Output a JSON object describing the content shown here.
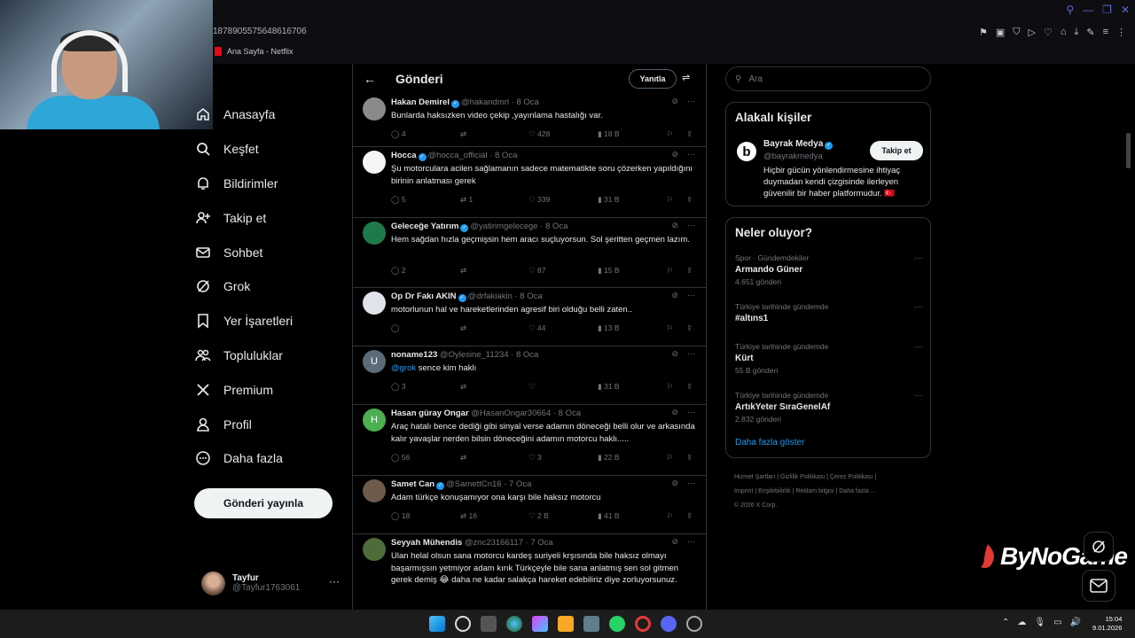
{
  "browser": {
    "address": "1878905575648616706",
    "bookmark_label": "Ana Sayfa - Netflix"
  },
  "nav": {
    "items": [
      {
        "label": "Anasayfa",
        "icon": "home-icon"
      },
      {
        "label": "Keşfet",
        "icon": "search-icon"
      },
      {
        "label": "Bildirimler",
        "icon": "bell-icon"
      },
      {
        "label": "Takip et",
        "icon": "follow-icon"
      },
      {
        "label": "Sohbet",
        "icon": "mail-icon"
      },
      {
        "label": "Grok",
        "icon": "grok-icon"
      },
      {
        "label": "Yer İşaretleri",
        "icon": "bookmark-icon"
      },
      {
        "label": "Topluluklar",
        "icon": "communities-icon"
      },
      {
        "label": "Premium",
        "icon": "x-logo-icon"
      },
      {
        "label": "Profil",
        "icon": "profile-icon"
      },
      {
        "label": "Daha fazla",
        "icon": "more-circle-icon"
      }
    ],
    "post_button": "Gönderi yayınla"
  },
  "profile": {
    "name": "Tayfur",
    "handle": "@Tayfur1763061"
  },
  "header": {
    "title": "Gönderi",
    "reply_button": "Yanıtla"
  },
  "tweets": [
    {
      "name": "Hakan Demirel",
      "verified": true,
      "handle": "@hakandmrl",
      "date": "· 8 Oca",
      "text": "Bunlarda haksızken video çekip ,yayınlama hastalığı var.",
      "replies": "4",
      "retweets": "",
      "likes": "428",
      "views": "18 B",
      "avatar_color": "#8a8a8a",
      "avatar_letter": ""
    },
    {
      "name": "Hocca",
      "verified": true,
      "handle": "@hocca_official",
      "date": "· 8 Oca",
      "text": "Şu motorculara acilen sağlamanın sadece matematikte soru çözerken yapıldığını birinin anlatması gerek",
      "replies": "5",
      "retweets": "1",
      "likes": "339",
      "views": "31 B",
      "avatar_color": "#f5f5f5",
      "avatar_letter": ""
    },
    {
      "name": "Geleceğe Yatırım",
      "verified": true,
      "handle": "@yatirimgelecege",
      "date": "· 8 Oca",
      "text": "Hem sağdan hızla geçmişsin hem aracı suçluyorsun. Sol şeritten geçmen lazım.",
      "replies": "2",
      "retweets": "",
      "likes": "87",
      "views": "15 B",
      "avatar_color": "#1f7a4a",
      "avatar_letter": ""
    },
    {
      "name": "Op Dr Fakı AKIN",
      "verified": true,
      "handle": "@drfakiakin",
      "date": "· 8 Oca",
      "text": "motorlunun hal ve hareketlerinden agresif biri olduğu belli zaten..",
      "replies": "",
      "retweets": "",
      "likes": "44",
      "views": "13 B",
      "avatar_color": "#e0e4ea",
      "avatar_letter": ""
    },
    {
      "name": "noname123",
      "verified": false,
      "handle": "@Oylesine_11234",
      "date": "· 8 Oca",
      "mention": "@grok",
      "text": "sence kim haklı",
      "replies": "3",
      "retweets": "",
      "likes": "",
      "views": "31 B",
      "avatar_color": "#5b6b78",
      "avatar_letter": "U"
    },
    {
      "name": "Hasan güray Ongar",
      "verified": false,
      "handle": "@HasanOngar30664",
      "date": "· 8 Oca",
      "text": "Araç hatalı bence dediği gibi sinyal verse adamın döneceği belli olur ve arkasında kalır yavaşlar nerden bilsin döneceğini adamın motorcu haklı.....",
      "replies": "56",
      "retweets": "",
      "likes": "3",
      "views": "22 B",
      "avatar_color": "#4caf50",
      "avatar_letter": "H"
    },
    {
      "name": "Samet Can",
      "verified": true,
      "handle": "@SamettCn16",
      "date": "· 7 Oca",
      "text": "Adam türkçe konuşamıyor ona karşı bile haksız motorcu",
      "replies": "18",
      "retweets": "16",
      "likes": "2 B",
      "views": "41 B",
      "avatar_color": "#6d5a4a",
      "avatar_letter": ""
    },
    {
      "name": "Seyyah Mühendis",
      "verified": false,
      "handle": "@znc23166117",
      "date": "· 7 Oca",
      "text": "Ulan helal olsun sana motorcu kardeş suriyeli krşısında bile haksız olmayı başarmışsın yetmiyor adam kırık Türkçeyle bile sana anlatmış sen sol gitmen gerek demiş 😂 daha ne kadar salakça hareket edebiliriz diye zorluyorsunuz.",
      "replies": "",
      "retweets": "",
      "likes": "",
      "views": "",
      "avatar_color": "#4e6b3a",
      "avatar_letter": ""
    }
  ],
  "search": {
    "placeholder": "Ara"
  },
  "related": {
    "title": "Alakalı kişiler",
    "name": "Bayrak Medya",
    "handle": "@bayrakmedya",
    "bio": "Hiçbir gücün yönlendirmesine ihtiyaç duymadan kendi çizgisinde ilerleyen güvenilir bir haber platformudur. 🇹🇷",
    "follow": "Takip et",
    "avatar_letter": "b"
  },
  "trends": {
    "title": "Neler oluyor?",
    "items": [
      {
        "category": "Spor · Gündemdekiler",
        "title": "Armando Güner",
        "count": "4.651 gönderi"
      },
      {
        "category": "Türkiye tarihinde gündemde",
        "title": "#altıns1",
        "count": ""
      },
      {
        "category": "Türkiye tarihinde gündemde",
        "title": "Kürt",
        "count": "55 B gönderi"
      },
      {
        "category": "Türkiye tarihinde gündemde",
        "title": "ArtıkYeter SıraGenelAf",
        "count": "2.832 gönderi"
      }
    ],
    "show_more": "Daha fazla göster"
  },
  "footer": {
    "line1": "Hizmet Şartları  |  Gizlilik Politikası  |  Çerez Politikası  |",
    "line2": "Imprint  |  Erişilebilirlik  |  Reklam bilgisi  |  Daha fazla ...",
    "line3": "© 2026 X Corp."
  },
  "watermark": "ByNoGame",
  "clock": {
    "time": "15:04",
    "date": "9.01.2026"
  }
}
